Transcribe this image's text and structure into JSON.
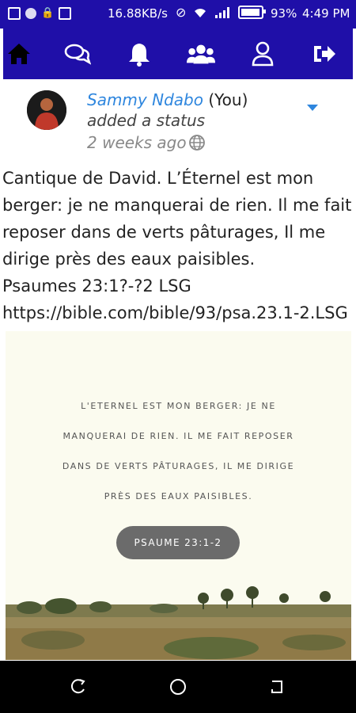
{
  "status_bar": {
    "speed": "16.88KB/s",
    "battery_percent": "93%",
    "time": "4:49 PM"
  },
  "nav": {
    "items": [
      {
        "name": "home-icon"
      },
      {
        "name": "chat-icon"
      },
      {
        "name": "bell-icon"
      },
      {
        "name": "group-icon"
      },
      {
        "name": "profile-icon"
      },
      {
        "name": "logout-icon"
      }
    ]
  },
  "post": {
    "author": "Sammy Ndabo",
    "you_label": "(You)",
    "action": "added a status",
    "time": "2 weeks ago",
    "text": "Cantique de David. L’Éternel est mon berger: je ne manquerai de rien. Il me fait reposer dans de verts pâturages, Il me dirige près des eaux paisibles.\nPsaumes 23:1?-?2 LSG\nhttps://bible.com/bible/93/psa.23.1-2.LSG",
    "image": {
      "quote_lines": [
        "L'ETERNEL EST MON BERGER: JE NE",
        "MANQUERAI DE RIEN. IL ME FAIT REPOSER",
        "DANS DE VERTS PÂTURAGES, IL ME DIRIGE",
        "PRÈS DES EAUX PAISIBLES."
      ],
      "reference": "PSAUME 23:1-2"
    }
  }
}
